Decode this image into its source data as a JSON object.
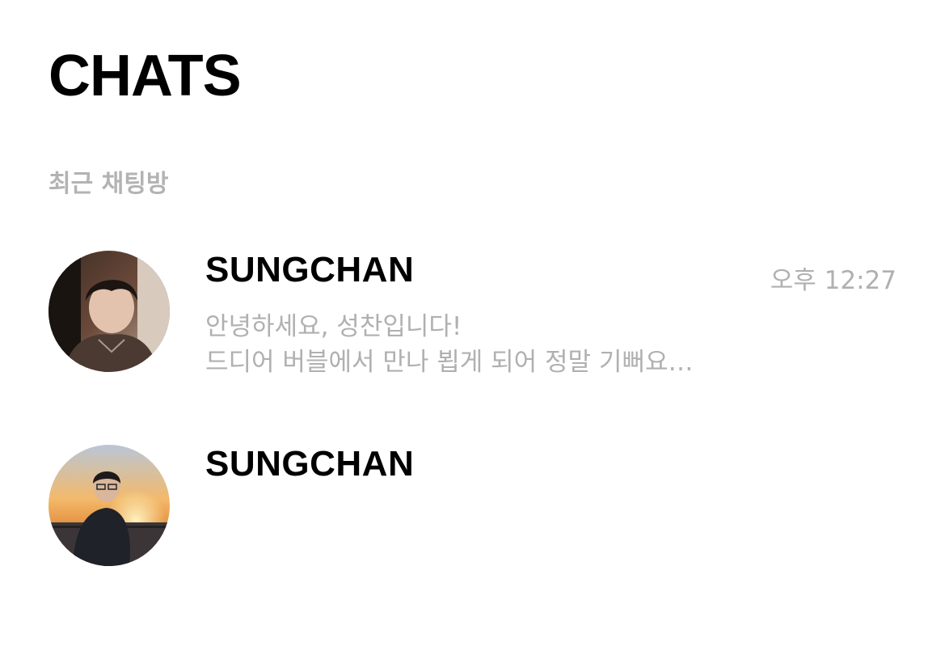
{
  "header": {
    "title": "CHATS",
    "section_label": "최근 채팅방"
  },
  "chats": [
    {
      "name": "SUNGCHAN",
      "time": "오후 12:27",
      "preview_line1": "안녕하세요, 성찬입니다!",
      "preview_line2": "드디어 버블에서 만나 뵙게 되어 정말 기뻐요…",
      "avatar_icon": "profile-photo-dark-room"
    },
    {
      "name": "SUNGCHAN",
      "avatar_icon": "profile-photo-sunset"
    }
  ],
  "colors": {
    "title": "#000000",
    "muted_text": "#b0b0b0",
    "background": "#ffffff"
  }
}
